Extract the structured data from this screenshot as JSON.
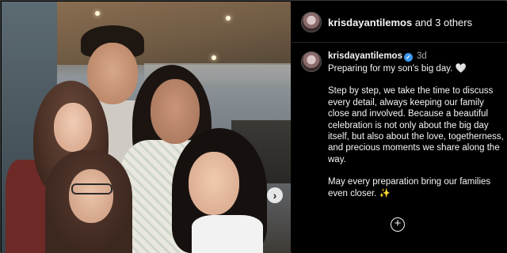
{
  "header": {
    "username": "krisdayantilemos",
    "collab_suffix": " and 3 others"
  },
  "post": {
    "username": "krisdayantilemos",
    "verified_glyph": "✓",
    "time": "3d",
    "caption_lines": [
      "Preparing for my son's big day. 🤍",
      "Step by step, we take the time to discuss every detail, always keeping our family close and involved. Because a beautiful celebration is not only about the big day itself, but also about the love, togetherness, and precious moments we share along the way.",
      "May every preparation bring our  families even closer. ✨"
    ]
  },
  "controls": {
    "carousel_next_glyph": "›",
    "add_glyph": "+"
  },
  "icons": {
    "avatar": "avatar-icon",
    "verified": "verified-badge-icon",
    "carousel_next": "chevron-right-icon",
    "add": "plus-circle-icon"
  },
  "colors": {
    "background": "#000000",
    "text": "#f5f5f5",
    "muted": "#a8a8a8",
    "verified": "#3897f0"
  }
}
